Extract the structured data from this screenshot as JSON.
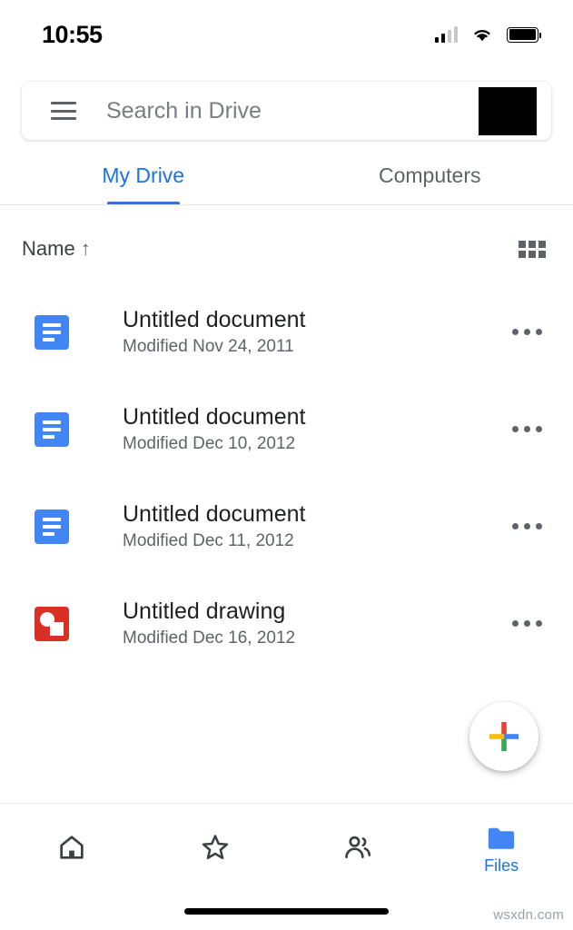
{
  "status_bar": {
    "time": "10:55",
    "cellular_icon": "cellular-signal-icon",
    "cellular_bars_filled": 2,
    "cellular_bars_total": 4,
    "wifi_icon": "wifi-icon",
    "battery_icon": "battery-full-icon"
  },
  "search": {
    "menu_icon": "hamburger-menu-icon",
    "placeholder": "Search in Drive",
    "avatar_label": "account-avatar"
  },
  "tabs": [
    {
      "label": "My Drive",
      "active": true
    },
    {
      "label": "Computers",
      "active": false
    }
  ],
  "list_header": {
    "sort_label": "Name",
    "sort_arrow": "↑",
    "sort_direction": "ascending",
    "view_toggle_icon": "grid-view-icon"
  },
  "files": [
    {
      "name": "Untitled document",
      "modified": "Modified Nov 24, 2011",
      "icon": "google-docs-icon",
      "type": "doc"
    },
    {
      "name": "Untitled document",
      "modified": "Modified Dec 10, 2012",
      "icon": "google-docs-icon",
      "type": "doc"
    },
    {
      "name": "Untitled document",
      "modified": "Modified Dec 11, 2012",
      "icon": "google-docs-icon",
      "type": "doc"
    },
    {
      "name": "Untitled drawing",
      "modified": "Modified Dec 16, 2012",
      "icon": "google-drawings-icon",
      "type": "drawing"
    }
  ],
  "fab": {
    "icon": "plus-icon",
    "label": "Create new"
  },
  "bottom_nav": [
    {
      "label": "",
      "icon": "home-icon",
      "active": false
    },
    {
      "label": "",
      "icon": "star-icon",
      "active": false
    },
    {
      "label": "",
      "icon": "shared-people-icon",
      "active": false
    },
    {
      "label": "Files",
      "icon": "folder-icon",
      "active": true
    }
  ],
  "watermark": "wsxdn.com",
  "colors": {
    "accent_blue": "#1a73e8",
    "tab_underline": "#3b6fd4",
    "docs_blue": "#4285f4",
    "drawing_red": "#d93025",
    "folder_blue": "#4285f4",
    "text_primary": "#202124",
    "text_secondary": "#5f6368",
    "plus_red": "#ea4335",
    "plus_yellow": "#fbbc04",
    "plus_blue": "#4285f4",
    "plus_green": "#34a853"
  }
}
